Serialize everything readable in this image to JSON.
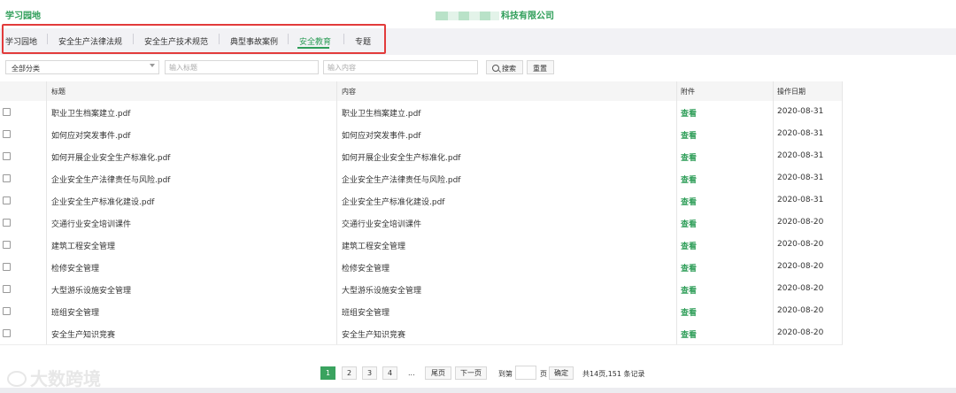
{
  "header": {
    "app_title": "学习园地",
    "company_suffix": "科技有限公司"
  },
  "tabs": [
    {
      "label": "学习园地",
      "active": false
    },
    {
      "label": "安全生产法律法规",
      "active": false
    },
    {
      "label": "安全生产技术规范",
      "active": false
    },
    {
      "label": "典型事故案例",
      "active": false
    },
    {
      "label": "安全教育",
      "active": true
    },
    {
      "label": "专题",
      "active": false
    }
  ],
  "filter": {
    "category_value": "全部分类",
    "title_placeholder": "输入标题",
    "content_placeholder": "输入内容",
    "search_label": "搜索",
    "reset_label": "重置"
  },
  "table": {
    "columns": [
      "标题",
      "内容",
      "附件",
      "操作日期"
    ],
    "rows": [
      {
        "title": "职业卫生档案建立.pdf",
        "content": "职业卫生档案建立.pdf",
        "attachment": "查看",
        "date": "2020-08-31"
      },
      {
        "title": "如何应对突发事件.pdf",
        "content": "如何应对突发事件.pdf",
        "attachment": "查看",
        "date": "2020-08-31"
      },
      {
        "title": "如何开展企业安全生产标准化.pdf",
        "content": "如何开展企业安全生产标准化.pdf",
        "attachment": "查看",
        "date": "2020-08-31"
      },
      {
        "title": "企业安全生产法律责任与风险.pdf",
        "content": "企业安全生产法律责任与风险.pdf",
        "attachment": "查看",
        "date": "2020-08-31"
      },
      {
        "title": "企业安全生产标准化建设.pdf",
        "content": "企业安全生产标准化建设.pdf",
        "attachment": "查看",
        "date": "2020-08-31"
      },
      {
        "title": "交通行业安全培训课件",
        "content": "交通行业安全培训课件",
        "attachment": "查看",
        "date": "2020-08-20"
      },
      {
        "title": "建筑工程安全管理",
        "content": "建筑工程安全管理",
        "attachment": "查看",
        "date": "2020-08-20"
      },
      {
        "title": "检修安全管理",
        "content": "检修安全管理",
        "attachment": "查看",
        "date": "2020-08-20"
      },
      {
        "title": "大型游乐设施安全管理",
        "content": "大型游乐设施安全管理",
        "attachment": "查看",
        "date": "2020-08-20"
      },
      {
        "title": "班组安全管理",
        "content": "班组安全管理",
        "attachment": "查看",
        "date": "2020-08-20"
      },
      {
        "title": "安全生产知识竞赛",
        "content": "安全生产知识竞赛",
        "attachment": "查看",
        "date": "2020-08-20"
      }
    ]
  },
  "pagination": {
    "pages": [
      "1",
      "2",
      "3",
      "4"
    ],
    "current": "1",
    "ellipsis": "...",
    "last_label": "尾页",
    "next_label": "下一页",
    "goto_prefix": "到第",
    "goto_suffix": "页",
    "confirm_label": "确定",
    "summary": "共14页,151 条记录"
  },
  "watermark": {
    "text": "大数跨境"
  },
  "colors": {
    "accent": "#2f9e59",
    "highlight_border": "#e23b3b"
  }
}
